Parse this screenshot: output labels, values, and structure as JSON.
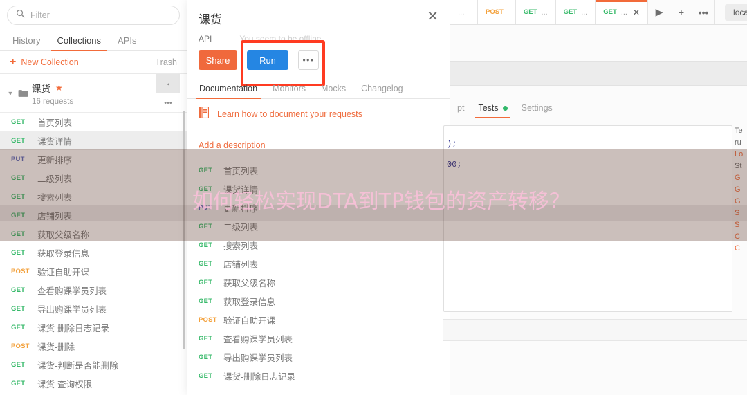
{
  "sidebar": {
    "search": {
      "placeholder": "Filter",
      "value": "",
      "icon": "search-icon"
    },
    "tabs": [
      {
        "label": "History",
        "active": false
      },
      {
        "label": "Collections",
        "active": true
      },
      {
        "label": "APIs",
        "active": false
      }
    ],
    "new_collection_label": "New Collection",
    "trash_label": "Trash",
    "collection": {
      "name": "课货",
      "starred": true,
      "requests_count_label": "16 requests",
      "caret": "collapse-caret-icon",
      "folder_icon": "folder-icon",
      "action_collapse": "◂",
      "action_more": "•••"
    },
    "requests": [
      {
        "method": "GET",
        "name": "首页列表",
        "selected": false
      },
      {
        "method": "GET",
        "name": "课货详情",
        "selected": true
      },
      {
        "method": "PUT",
        "name": "更新排序",
        "selected": false
      },
      {
        "method": "GET",
        "name": "二级列表",
        "selected": false
      },
      {
        "method": "GET",
        "name": "搜索列表",
        "selected": false
      },
      {
        "method": "GET",
        "name": "店铺列表",
        "selected": false
      },
      {
        "method": "GET",
        "name": "获取父级名称",
        "selected": false
      },
      {
        "method": "GET",
        "name": "获取登录信息",
        "selected": false
      },
      {
        "method": "POST",
        "name": "验证自助开课",
        "selected": false
      },
      {
        "method": "GET",
        "name": "查看购课学员列表",
        "selected": false
      },
      {
        "method": "GET",
        "name": "导出购课学员列表",
        "selected": false
      },
      {
        "method": "GET",
        "name": "课货-删除日志记录",
        "selected": false
      },
      {
        "method": "POST",
        "name": "课货-删除",
        "selected": false
      },
      {
        "method": "GET",
        "name": "课货-判断是否能删除",
        "selected": false
      },
      {
        "method": "GET",
        "name": "课货-查询权限",
        "selected": false
      }
    ]
  },
  "modal": {
    "title": "课货",
    "close_icon": "close-icon",
    "api_label": "API",
    "offline_text": "You seem to be offline",
    "buttons": {
      "share": "Share",
      "run": "Run",
      "more": "•••"
    },
    "tabs": [
      {
        "label": "Documentation",
        "active": true
      },
      {
        "label": "Monitors",
        "active": false
      },
      {
        "label": "Mocks",
        "active": false
      },
      {
        "label": "Changelog",
        "active": false
      }
    ],
    "learn_link": "Learn how to document your requests",
    "learn_icon": "book-icon",
    "description_link": "Add a description",
    "requests": [
      {
        "method": "GET",
        "name": "首页列表"
      },
      {
        "method": "GET",
        "name": "课货详情"
      },
      {
        "method": "PUT",
        "name": "更新排序"
      },
      {
        "method": "GET",
        "name": "二级列表"
      },
      {
        "method": "GET",
        "name": "搜索列表"
      },
      {
        "method": "GET",
        "name": "店铺列表"
      },
      {
        "method": "GET",
        "name": "获取父级名称"
      },
      {
        "method": "GET",
        "name": "获取登录信息"
      },
      {
        "method": "POST",
        "name": "验证自助开课"
      },
      {
        "method": "GET",
        "name": "查看购课学员列表"
      },
      {
        "method": "GET",
        "name": "导出购课学员列表"
      },
      {
        "method": "GET",
        "name": "课货-删除日志记录"
      }
    ]
  },
  "workspace": {
    "tabs": [
      {
        "method": "",
        "name": "...",
        "active": false,
        "closable": false
      },
      {
        "method": "POST",
        "name": "",
        "active": false,
        "closable": false
      },
      {
        "method": "GET",
        "name": "...",
        "active": false,
        "closable": false
      },
      {
        "method": "GET",
        "name": "...",
        "active": false,
        "closable": false
      },
      {
        "method": "GET",
        "name": "...",
        "active": true,
        "closable": true
      }
    ],
    "tab_icons": [
      {
        "glyph": "▶",
        "name": "runner-play-icon"
      },
      {
        "glyph": "+",
        "name": "new-tab-icon"
      },
      {
        "glyph": "•••",
        "name": "tab-more-icon"
      }
    ],
    "environment": "local",
    "request_tabs": [
      {
        "label": "pt",
        "active": false,
        "dot": false
      },
      {
        "label": "Tests",
        "active": true,
        "dot": true
      },
      {
        "label": "Settings",
        "active": false,
        "dot": false
      }
    ],
    "code_lines": [
      ");",
      "00;"
    ],
    "snippets": [
      {
        "text": "Te",
        "type": "plain"
      },
      {
        "text": "ru",
        "type": "plain"
      },
      {
        "text": "Lo",
        "type": "link"
      },
      {
        "text": "St",
        "type": "plain"
      },
      {
        "text": "G",
        "type": "link"
      },
      {
        "text": "G",
        "type": "link"
      },
      {
        "text": "G",
        "type": "link"
      },
      {
        "text": "S",
        "type": "link"
      },
      {
        "text": "S",
        "type": "link"
      },
      {
        "text": "C",
        "type": "link"
      },
      {
        "text": "C",
        "type": "link"
      }
    ]
  },
  "watermark": {
    "text": "如何轻松实现DTA到TP钱包的资产转移？"
  },
  "colors": {
    "accent": "#f26b3a",
    "share": "#f0693c",
    "run": "#2586e3",
    "get": "#37b96a",
    "post": "#f3a13c",
    "put": "#5b6bbf",
    "annotation": "#ff3b21",
    "watermark": "#ffc1dd"
  }
}
